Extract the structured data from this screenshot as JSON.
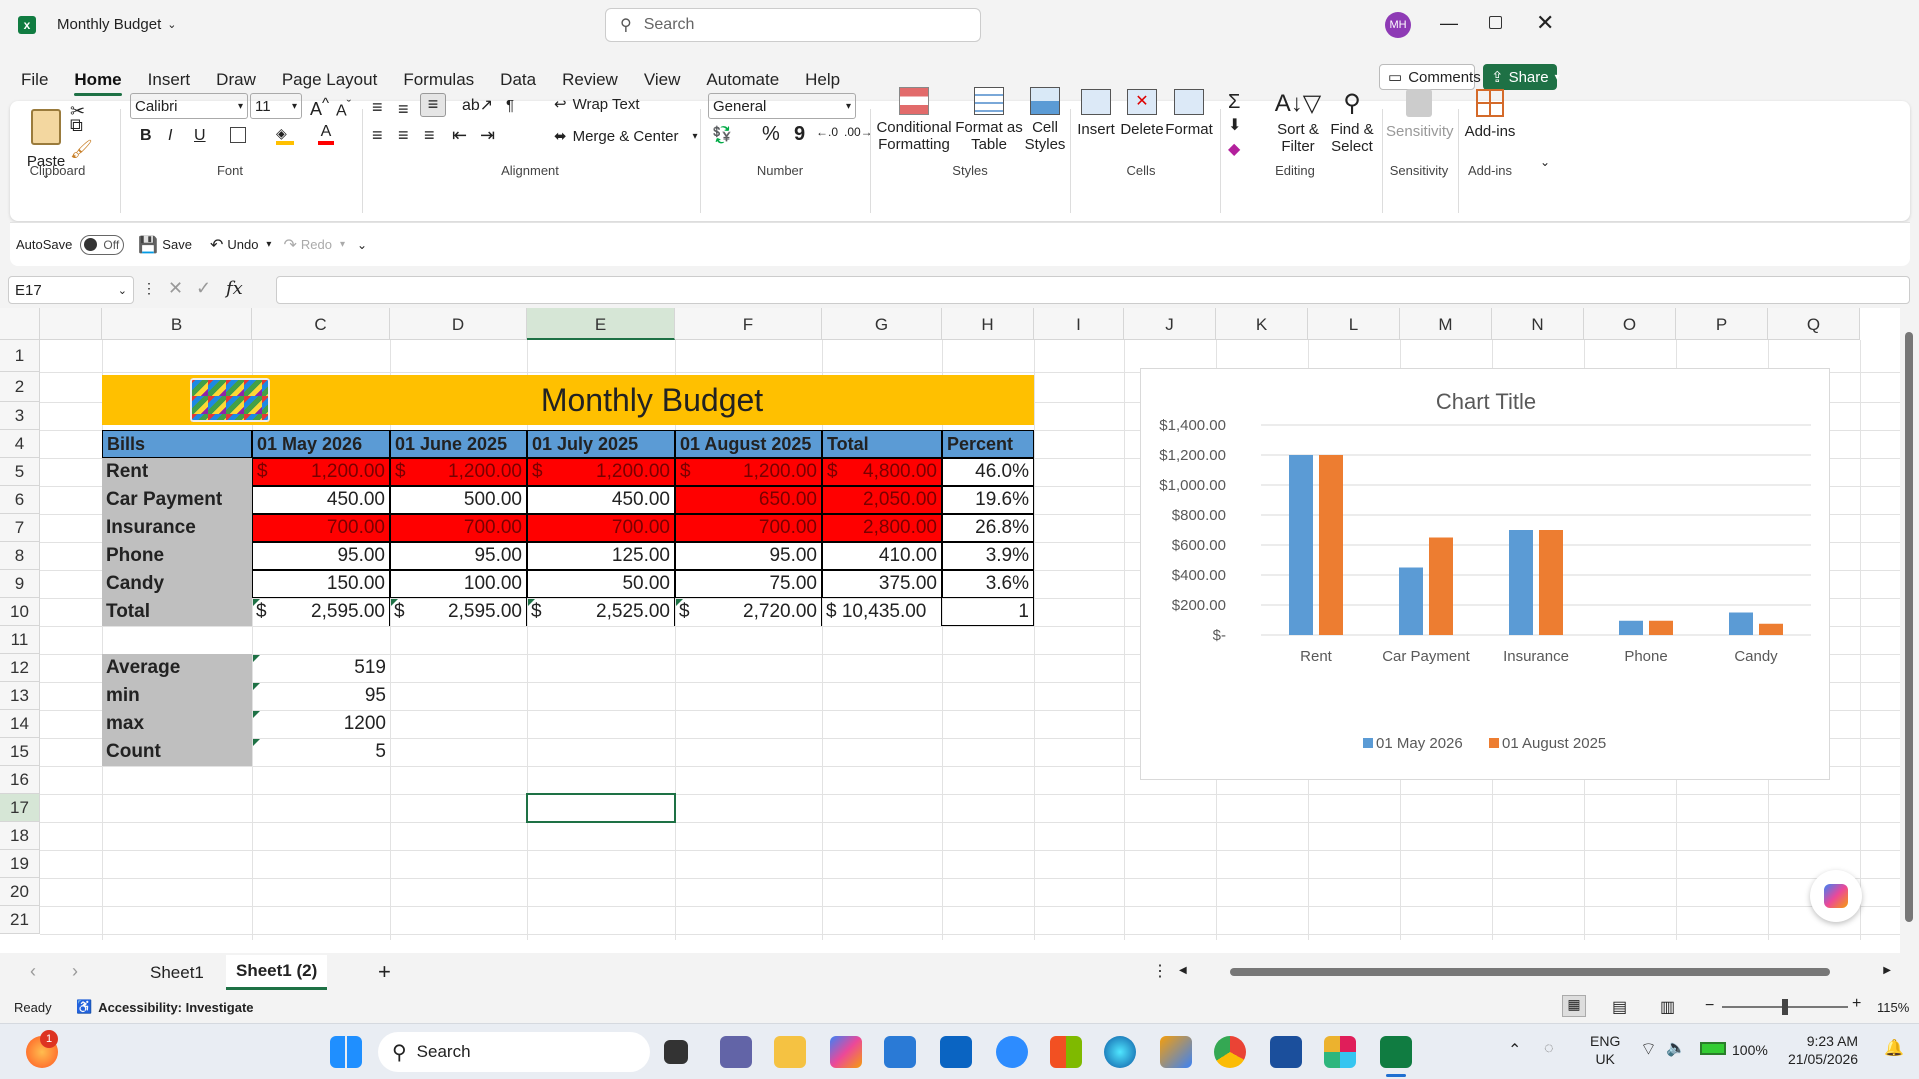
{
  "window": {
    "title": "Monthly Budget",
    "search_placeholder": "Search",
    "avatar_initials": "MH"
  },
  "ribbon_tabs": [
    "File",
    "Home",
    "Insert",
    "Draw",
    "Page Layout",
    "Formulas",
    "Data",
    "Review",
    "View",
    "Automate",
    "Help"
  ],
  "comments_label": "Comments",
  "share_label": "Share",
  "ribbon": {
    "clipboard": {
      "paste": "Paste",
      "label": "Clipboard"
    },
    "font": {
      "name": "Calibri",
      "size": "11",
      "label": "Font",
      "bold": "B",
      "italic": "I",
      "underline": "U"
    },
    "alignment": {
      "wrap": "Wrap Text",
      "merge": "Merge & Center",
      "label": "Alignment"
    },
    "number": {
      "format": "General",
      "label": "Number",
      "percent": "%",
      "comma": "9"
    },
    "styles": {
      "conditional": [
        "Conditional",
        "Formatting"
      ],
      "format_table": [
        "Format as",
        "Table"
      ],
      "cell_styles": [
        "Cell",
        "Styles"
      ],
      "label": "Styles"
    },
    "cells": {
      "insert": "Insert",
      "delete": "Delete",
      "format": "Format",
      "label": "Cells"
    },
    "editing": {
      "sort": [
        "Sort &",
        "Filter"
      ],
      "find": [
        "Find &",
        "Select"
      ],
      "label": "Editing"
    },
    "sensitivity": {
      "name": "Sensitivity",
      "label": "Sensitivity"
    },
    "addins": {
      "name": "Add-ins",
      "label": "Add-ins"
    }
  },
  "qat": {
    "autosave": "AutoSave",
    "toggle": "Off",
    "save": "Save",
    "undo": "Undo",
    "redo": "Redo"
  },
  "formula": {
    "namebox": "E17",
    "fx": "fx",
    "value": ""
  },
  "columns": [
    "B",
    "C",
    "D",
    "E",
    "F",
    "G",
    "H",
    "I",
    "J",
    "K",
    "L",
    "M",
    "N",
    "O",
    "P",
    "Q"
  ],
  "rows": [
    "1",
    "2",
    "3",
    "4",
    "5",
    "6",
    "7",
    "8",
    "9",
    "10",
    "11",
    "12",
    "13",
    "14",
    "15",
    "16",
    "17",
    "18",
    "19",
    "20",
    "21"
  ],
  "sheet": {
    "title": "Monthly Budget",
    "headers": [
      "Bills",
      "01 May 2026",
      "01 June 2025",
      "01 July 2025",
      "01 August 2025",
      "Total",
      "Percent"
    ],
    "rows": [
      {
        "name": "Rent",
        "vals": [
          "$",
          "1,200.00",
          "$",
          "1,200.00",
          "$",
          "1,200.00",
          "$",
          "1,200.00",
          "$",
          "4,800.00"
        ],
        "pct": "46.0%"
      },
      {
        "name": "Car Payment",
        "vals": [
          "450.00",
          "500.00",
          "450.00",
          "650.00",
          "2,050.00"
        ],
        "pct": "19.6%"
      },
      {
        "name": "Insurance",
        "vals": [
          "700.00",
          "700.00",
          "700.00",
          "700.00",
          "2,800.00"
        ],
        "pct": "26.8%"
      },
      {
        "name": "Phone",
        "vals": [
          "95.00",
          "95.00",
          "125.00",
          "95.00",
          "410.00"
        ],
        "pct": "3.9%"
      },
      {
        "name": "Candy",
        "vals": [
          "150.00",
          "100.00",
          "50.00",
          "75.00",
          "375.00"
        ],
        "pct": "3.6%"
      }
    ],
    "total": {
      "name": "Total",
      "cur": "$",
      "vals": [
        "2,595.00",
        "2,595.00",
        "2,525.00",
        "2,720.00"
      ],
      "grand": "$ 10,435.00",
      "pct": "1"
    },
    "stats": [
      {
        "label": "Average",
        "value": "519"
      },
      {
        "label": "min",
        "value": "95"
      },
      {
        "label": "max",
        "value": "1200"
      },
      {
        "label": "Count",
        "value": "5"
      }
    ]
  },
  "chart_data": {
    "type": "bar",
    "title": "Chart Title",
    "categories": [
      "Rent",
      "Car Payment",
      "Insurance",
      "Phone",
      "Candy"
    ],
    "series": [
      {
        "name": "01 May 2026",
        "values": [
          1200,
          450,
          700,
          95,
          150
        ],
        "color": "#5b9bd5"
      },
      {
        "name": "01 August 2025",
        "values": [
          1200,
          650,
          700,
          95,
          75
        ],
        "color": "#ed7d31"
      }
    ],
    "yticks": [
      "$-",
      "$200.00",
      "$400.00",
      "$600.00",
      "$800.00",
      "$1,000.00",
      "$1,200.00",
      "$1,400.00"
    ],
    "ylim": [
      0,
      1400
    ],
    "legend": "bottom"
  },
  "sheets": [
    "Sheet1",
    "Sheet1 (2)"
  ],
  "status": {
    "ready": "Ready",
    "accessibility": "Accessibility: Investigate",
    "zoom": "115%"
  },
  "taskbar": {
    "search": "Search",
    "lang1": "ENG",
    "lang2": "UK",
    "battery": "100%",
    "time": "9:23 AM",
    "date": "21/05/2026",
    "badge": "1"
  }
}
